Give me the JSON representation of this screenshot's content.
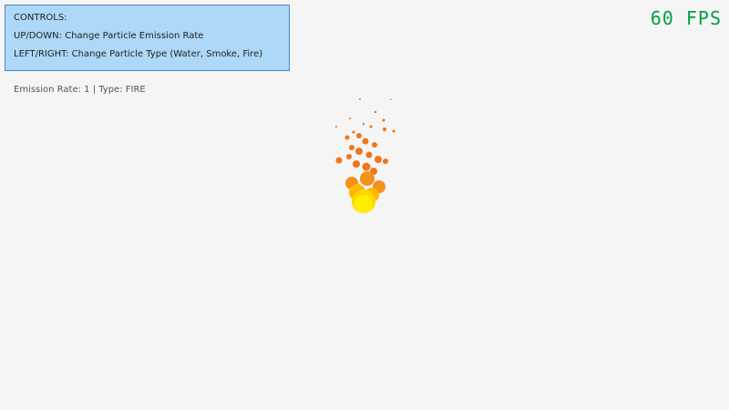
{
  "controls": {
    "title": "CONTROLS:",
    "line1": "UP/DOWN: Change Particle Emission Rate",
    "line2": "LEFT/RIGHT: Change Particle Type (Water, Smoke, Fire)"
  },
  "fps": "60 FPS",
  "status": "Emission Rate: 1 | Type: FIRE",
  "colors": {
    "panel_bg": "#add8f7",
    "panel_border": "#4a86c6",
    "fps": "#00a040",
    "fire_core": "#ffee00",
    "fire_mid": "#ffb800",
    "fire_outer": "#f07010"
  }
}
